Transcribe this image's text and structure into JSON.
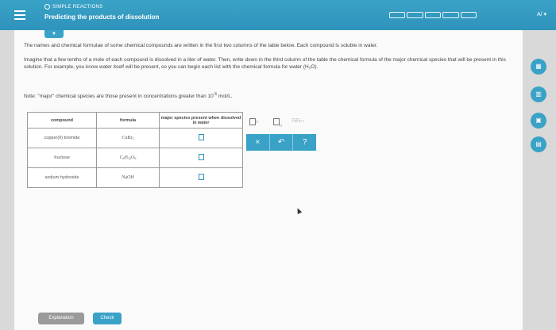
{
  "header": {
    "section": "SIMPLE REACTIONS",
    "title": "Predicting the products of dissolution",
    "lang": "A/ ▾"
  },
  "intro": {
    "line1": "The names and chemical formulae of some chemical compounds are written in the first two columns of the table below. Each compound is soluble in water.",
    "line2": "Imagine that a few tenths of a mole of each compound is dissolved in a liter of water. Then, write down in the third column of the table the chemical formula of the major chemical species that will be present in this solution. For example, you know water itself will be present, so you can begin each list with the chemical formula for water (H₂O).",
    "note": "Note: \"major\" chemical species are those present in concentrations greater than 10",
    "note_exp": "-6",
    "note_unit": " mol/L."
  },
  "table": {
    "headers": [
      "compound",
      "formula",
      "major species present when dissolved in water"
    ],
    "rows": [
      {
        "compound": "copper(II) bromide",
        "formula_main": "CuBr",
        "formula_sub": "2"
      },
      {
        "compound": "fructose",
        "formula_main": "C",
        "f1": "6",
        "f2": "H",
        "f3": "12",
        "f4": "O",
        "f5": "6"
      },
      {
        "compound": "sodium hydroxide",
        "formula_main": "NaOH"
      }
    ]
  },
  "tools": {
    "superscript": "□",
    "subscript": "□",
    "list": "□,□,..."
  },
  "actions": {
    "clear": "×",
    "undo": "↶",
    "help": "?"
  },
  "buttons": {
    "explanation": "Explanation",
    "check": "Check"
  }
}
